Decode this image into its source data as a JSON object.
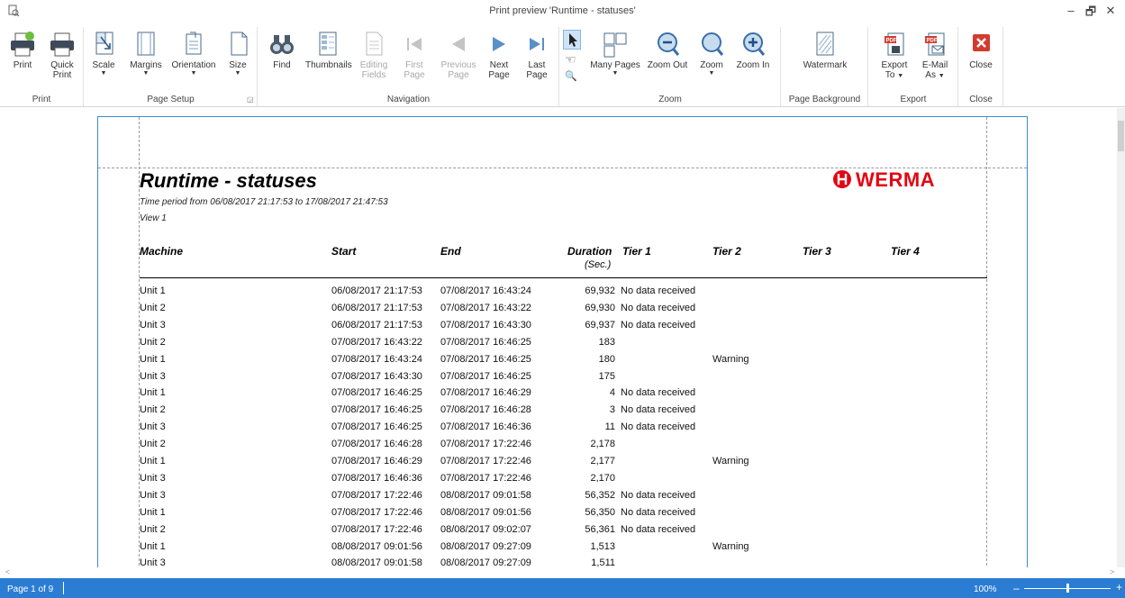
{
  "window": {
    "title": "Print preview 'Runtime - statuses'",
    "minimize": "–",
    "restore": "🗗",
    "close": "✕"
  },
  "ribbon": {
    "print_group": {
      "label": "Print",
      "print": "Print",
      "quick_print": [
        "Quick",
        "Print"
      ]
    },
    "page_setup_group": {
      "label": "Page Setup",
      "scale": "Scale",
      "margins": "Margins",
      "orientation": "Orientation",
      "size": "Size"
    },
    "navigation_group": {
      "label": "Navigation",
      "find": "Find",
      "thumbnails": "Thumbnails",
      "editing_fields": [
        "Editing",
        "Fields"
      ],
      "first_page": [
        "First",
        "Page"
      ],
      "previous_page": [
        "Previous",
        "Page"
      ],
      "next_page": [
        "Next",
        "Page"
      ],
      "last_page": [
        "Last",
        "Page"
      ]
    },
    "zoom_group": {
      "label": "Zoom",
      "many_pages": "Many Pages",
      "zoom_out": "Zoom Out",
      "zoom": "Zoom",
      "zoom_in": "Zoom In"
    },
    "background_group": {
      "label": "Page Background",
      "watermark": "Watermark"
    },
    "export_group": {
      "label": "Export",
      "export_to": [
        "Export",
        "To"
      ],
      "email_as": [
        "E-Mail",
        "As"
      ]
    },
    "close_group": {
      "label": "Close",
      "close": "Close"
    }
  },
  "report": {
    "title": "Runtime - statuses",
    "subtitle": "Time period from 06/08/2017 21:17:53 to 17/08/2017 21:47:53",
    "view": "View 1",
    "logo": "WERMA",
    "columns": {
      "machine": "Machine",
      "start": "Start",
      "end": "End",
      "duration": "Duration",
      "duration_unit": "(Sec.)",
      "tier1": "Tier 1",
      "tier2": "Tier 2",
      "tier3": "Tier 3",
      "tier4": "Tier 4"
    },
    "rows": [
      {
        "machine": "Unit 1",
        "start": "06/08/2017 21:17:53",
        "end": "07/08/2017 16:43:24",
        "duration": "69,932",
        "tier1": "No data received",
        "tier2": ""
      },
      {
        "machine": "Unit 2",
        "start": "06/08/2017 21:17:53",
        "end": "07/08/2017 16:43:22",
        "duration": "69,930",
        "tier1": "No data received",
        "tier2": ""
      },
      {
        "machine": "Unit 3",
        "start": "06/08/2017 21:17:53",
        "end": "07/08/2017 16:43:30",
        "duration": "69,937",
        "tier1": "No data received",
        "tier2": ""
      },
      {
        "machine": "Unit 2",
        "start": "07/08/2017 16:43:22",
        "end": "07/08/2017 16:46:25",
        "duration": "183",
        "tier1": "",
        "tier2": ""
      },
      {
        "machine": "Unit 1",
        "start": "07/08/2017 16:43:24",
        "end": "07/08/2017 16:46:25",
        "duration": "180",
        "tier1": "",
        "tier2": "Warning"
      },
      {
        "machine": "Unit 3",
        "start": "07/08/2017 16:43:30",
        "end": "07/08/2017 16:46:25",
        "duration": "175",
        "tier1": "",
        "tier2": ""
      },
      {
        "machine": "Unit 1",
        "start": "07/08/2017 16:46:25",
        "end": "07/08/2017 16:46:29",
        "duration": "4",
        "tier1": "No data received",
        "tier2": ""
      },
      {
        "machine": "Unit 2",
        "start": "07/08/2017 16:46:25",
        "end": "07/08/2017 16:46:28",
        "duration": "3",
        "tier1": "No data received",
        "tier2": ""
      },
      {
        "machine": "Unit 3",
        "start": "07/08/2017 16:46:25",
        "end": "07/08/2017 16:46:36",
        "duration": "11",
        "tier1": "No data received",
        "tier2": ""
      },
      {
        "machine": "Unit 2",
        "start": "07/08/2017 16:46:28",
        "end": "07/08/2017 17:22:46",
        "duration": "2,178",
        "tier1": "",
        "tier2": ""
      },
      {
        "machine": "Unit 1",
        "start": "07/08/2017 16:46:29",
        "end": "07/08/2017 17:22:46",
        "duration": "2,177",
        "tier1": "",
        "tier2": "Warning"
      },
      {
        "machine": "Unit 3",
        "start": "07/08/2017 16:46:36",
        "end": "07/08/2017 17:22:46",
        "duration": "2,170",
        "tier1": "",
        "tier2": ""
      },
      {
        "machine": "Unit 3",
        "start": "07/08/2017 17:22:46",
        "end": "08/08/2017 09:01:58",
        "duration": "56,352",
        "tier1": "No data received",
        "tier2": ""
      },
      {
        "machine": "Unit 1",
        "start": "07/08/2017 17:22:46",
        "end": "08/08/2017 09:01:56",
        "duration": "56,350",
        "tier1": "No data received",
        "tier2": ""
      },
      {
        "machine": "Unit 2",
        "start": "07/08/2017 17:22:46",
        "end": "08/08/2017 09:02:07",
        "duration": "56,361",
        "tier1": "No data received",
        "tier2": ""
      },
      {
        "machine": "Unit 1",
        "start": "08/08/2017 09:01:56",
        "end": "08/08/2017 09:27:09",
        "duration": "1,513",
        "tier1": "",
        "tier2": "Warning"
      },
      {
        "machine": "Unit 3",
        "start": "08/08/2017 09:01:58",
        "end": "08/08/2017 09:27:09",
        "duration": "1,511",
        "tier1": "",
        "tier2": ""
      }
    ]
  },
  "statusbar": {
    "page_info": "Page 1 of 9",
    "zoom_level": "100%",
    "zoom_minus": "–",
    "zoom_plus": "+"
  },
  "colors": {
    "accent": "#2b7cd3",
    "brand_red": "#e30613",
    "page_border": "#3c8bd1"
  }
}
